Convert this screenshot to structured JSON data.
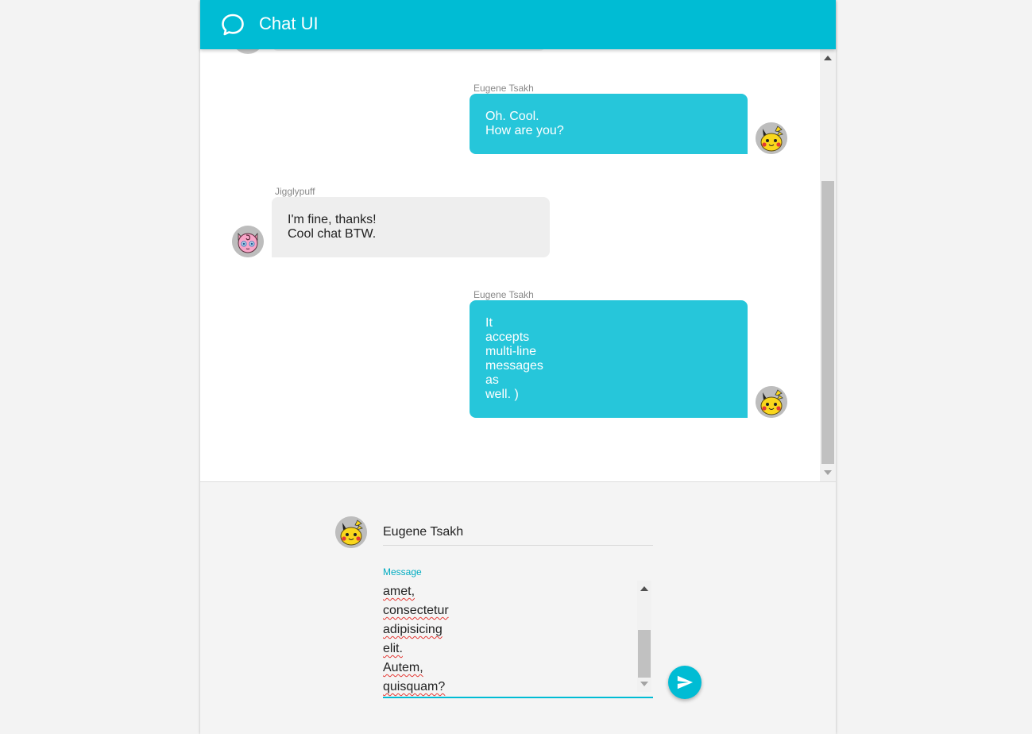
{
  "header": {
    "title": "Chat UI",
    "logo_icon": "chat-bubble-icon",
    "color": "#00bcd4"
  },
  "messages": [
    {
      "author": "Eugene Tsakh",
      "text": "Oh. Cool.\nHow are you?",
      "mine": true,
      "avatar_icon": "pikachu-avatar"
    },
    {
      "author": "Jigglypuff",
      "text": "I'm fine, thanks!\nCool chat BTW.",
      "mine": false,
      "avatar_icon": "jigglypuff-avatar"
    },
    {
      "author": "Eugene Tsakh",
      "text": "It\naccepts\nmulti-line\nmessages\nas\nwell. )",
      "mine": true,
      "avatar_icon": "pikachu-avatar"
    }
  ],
  "composer": {
    "name_value": "Eugene Tsakh",
    "message_label": "Message",
    "message_lines": [
      "amet,",
      "consectetur",
      "adipisicing",
      "elit.",
      "Autem,",
      "quisquam?"
    ],
    "send_icon": "send-icon"
  },
  "colors": {
    "my_bubble": "#26c6da",
    "their_bubble": "#eeeeee",
    "accent": "#00bcd4"
  }
}
